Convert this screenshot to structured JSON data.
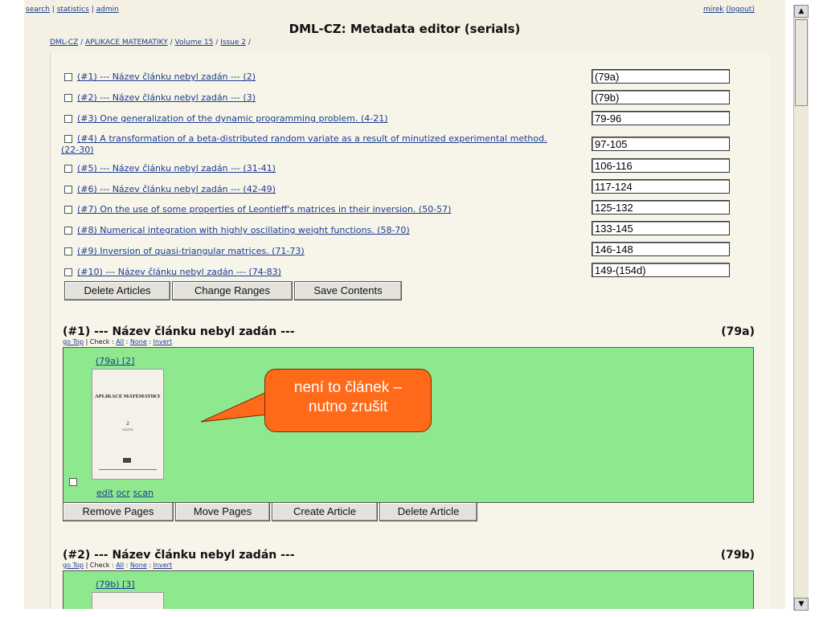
{
  "nav": {
    "search": "search",
    "statistics": "statistics",
    "admin": "admin",
    "user": "mirek",
    "logout": "(logout)",
    "sep": "|"
  },
  "page": {
    "title": "DML-CZ: Metadata editor (serials)"
  },
  "breadcrumb": {
    "items": [
      "DML-CZ",
      "APLIKACE MATEMATIKY",
      "Volume 15",
      "Issue 2"
    ],
    "sep": "/"
  },
  "articles": [
    {
      "label": "(#1) --- Název článku nebyl zadán --- (2)",
      "range": "(79a)"
    },
    {
      "label": "(#2) --- Název článku nebyl zadán --- (3)",
      "range": "(79b)"
    },
    {
      "label": "(#3) One generalization of the dynamic programming problem. (4-21)",
      "range": "79-96"
    },
    {
      "label": "(#4) A transformation of a beta-distributed random variate as a result of minutized experimental method.",
      "label2": "(22-30)",
      "range": "97-105"
    },
    {
      "label": "(#5) --- Název článku nebyl zadán --- (31-41)",
      "range": "106-116"
    },
    {
      "label": "(#6) --- Název článku nebyl zadán --- (42-49)",
      "range": "117-124"
    },
    {
      "label": "(#7) On the use of some properties of Leontieff's matrices in their inversion. (50-57)",
      "range": "125-132"
    },
    {
      "label": "(#8) Numerical integration with highly oscillating weight functions. (58-70)",
      "range": "133-145"
    },
    {
      "label": "(#9) Inversion of quasi-triangular matrices. (71-73)",
      "range": "146-148"
    },
    {
      "label": "(#10) --- Název článku nebyl zadán --- (74-83)",
      "range": "149-(154d)"
    }
  ],
  "toolbar": {
    "delete_articles": "Delete Articles",
    "change_ranges": "Change Ranges",
    "save_contents": "Save Contents"
  },
  "sections": [
    {
      "title": "(#1) --- Název článku nebyl zadán ---",
      "range": "(79a)",
      "sub_gotop": "go Top",
      "sub_check": "| Check :",
      "sub_all": "All",
      "sub_none": "None",
      "sub_invert": "Invert",
      "sub_colon": ":",
      "page_link": "(79a) [2]",
      "cover_title": "APLIKACE MATEMATIKY",
      "cover_number": "2",
      "cover_year": "SVAZEK",
      "edit": "edit",
      "ocr": "ocr",
      "scan": "scan"
    },
    {
      "title": "(#2) --- Název článku nebyl zadán ---",
      "range": "(79b)",
      "sub_gotop": "go Top",
      "sub_check": "| Check :",
      "sub_all": "All",
      "sub_none": "None",
      "sub_invert": "Invert",
      "sub_colon": ":",
      "page_link": "(79b) [3]"
    }
  ],
  "section_buttons": {
    "remove_pages": "Remove Pages",
    "move_pages": "Move Pages",
    "create_article": "Create Article",
    "delete_article": "Delete Article"
  },
  "callout": {
    "line1": "není to článek –",
    "line2": "nutno zrušit"
  },
  "scrollbar": {
    "up": "▲",
    "down": "▼"
  }
}
